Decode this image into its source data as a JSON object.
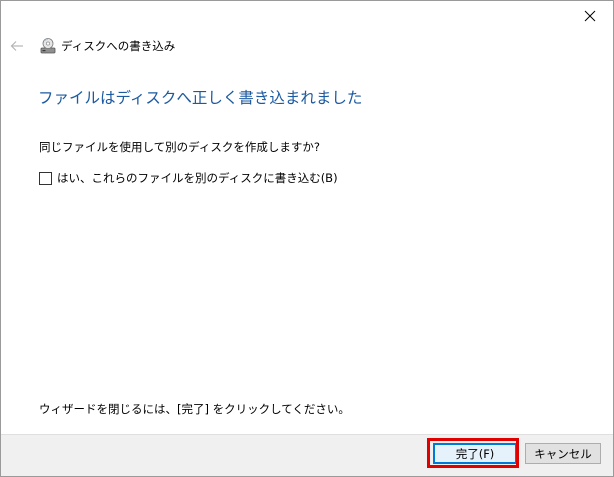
{
  "window": {
    "title": "ディスクへの書き込み",
    "close_icon": "close-icon",
    "back_icon": "back-arrow-icon",
    "wizard_icon": "disc-burner-icon"
  },
  "main": {
    "heading": "ファイルはディスクへ正しく書き込まれました",
    "question": "同じファイルを使用して別のディスクを作成しますか?",
    "checkbox": {
      "label": "はい、これらのファイルを別のディスクに書き込む(B)",
      "checked": false
    },
    "hint": "ウィザードを閉じるには、[完了] をクリックしてください。"
  },
  "footer": {
    "finish_label": "完了(F)",
    "cancel_label": "キャンセル"
  },
  "colors": {
    "heading": "#1c5aa0",
    "highlight": "#e00000",
    "focus_border": "#0078d7"
  }
}
